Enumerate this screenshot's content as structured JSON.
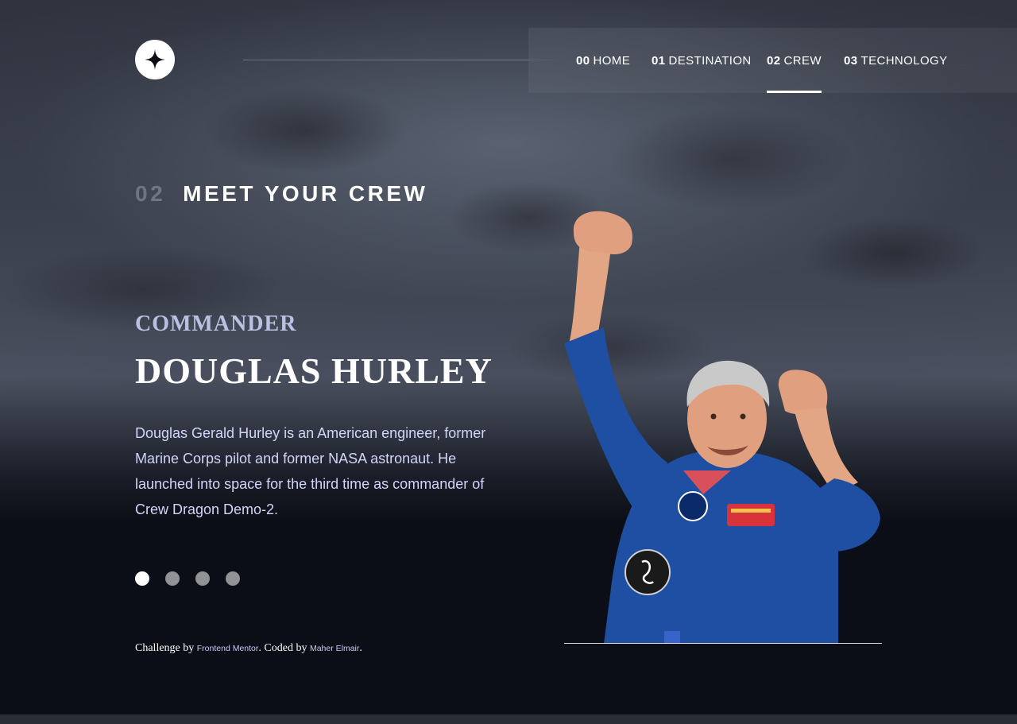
{
  "nav": {
    "items": [
      {
        "num": "00",
        "label": "HOME"
      },
      {
        "num": "01",
        "label": "DESTINATION"
      },
      {
        "num": "02",
        "label": "CREW"
      },
      {
        "num": "03",
        "label": "TECHNOLOGY"
      }
    ],
    "active_index": 2
  },
  "heading": {
    "num": "02",
    "text": "MEET YOUR CREW"
  },
  "crew": {
    "role": "COMMANDER",
    "name": "DOUGLAS HURLEY",
    "bio": "Douglas Gerald Hurley is an American engineer, former Marine Corps pilot and former NASA astronaut. He launched into space for the third time as commander of Crew Dragon Demo-2."
  },
  "pagination": {
    "count": 4,
    "active_index": 0
  },
  "footer": {
    "prefix": "Challenge by ",
    "link1": "Frontend Mentor",
    "middle": ". Coded by ",
    "link2": "Maher Elmair",
    "suffix": "."
  },
  "colors": {
    "background": "#0b0d17",
    "text": "#ffffff",
    "muted_text": "#d0d6f9",
    "suit_blue": "#1f4fa3"
  }
}
